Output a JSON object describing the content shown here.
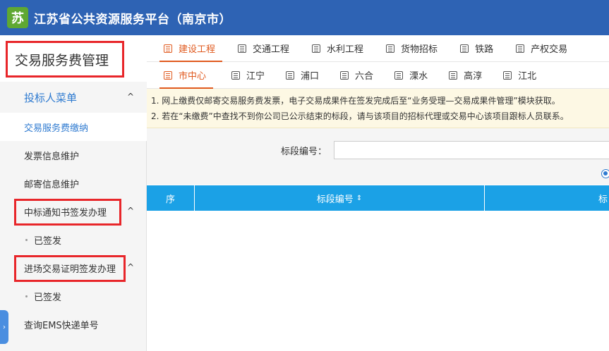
{
  "header": {
    "logo_text": "苏",
    "title": "江苏省公共资源服务平台（南京市）"
  },
  "sidebar": {
    "title": "交易服务费管理",
    "items": [
      {
        "label": "投标人菜单",
        "kind": "group-primary",
        "caret": "^"
      },
      {
        "label": "交易服务费缴纳",
        "kind": "active"
      },
      {
        "label": "发票信息维护",
        "kind": "item"
      },
      {
        "label": "邮寄信息维护",
        "kind": "item"
      },
      {
        "label": "中标通知书签发办理",
        "kind": "group",
        "caret": "^"
      },
      {
        "label": "已签发",
        "kind": "sub"
      },
      {
        "label": "进场交易证明签发办理",
        "kind": "group",
        "caret": "^"
      },
      {
        "label": "已签发",
        "kind": "sub"
      },
      {
        "label": "查询EMS快递单号",
        "kind": "item"
      }
    ],
    "toggle": "›"
  },
  "tabs_row1": [
    {
      "label": "建设工程",
      "active": true
    },
    {
      "label": "交通工程",
      "active": false
    },
    {
      "label": "水利工程",
      "active": false
    },
    {
      "label": "货物招标",
      "active": false
    },
    {
      "label": "铁路",
      "active": false
    },
    {
      "label": "产权交易",
      "active": false
    }
  ],
  "tabs_row2": [
    {
      "label": "市中心",
      "active": true
    },
    {
      "label": "江宁",
      "active": false
    },
    {
      "label": "浦口",
      "active": false
    },
    {
      "label": "六合",
      "active": false
    },
    {
      "label": "溧水",
      "active": false
    },
    {
      "label": "高淳",
      "active": false
    },
    {
      "label": "江北",
      "active": false
    }
  ],
  "notice": {
    "line1": "1. 网上缴费仅邮寄交易服务费发票，电子交易成果件在签发完成后至“业务受理—交易成果件管理”模块获取。",
    "line2": "2. 若在“未缴费”中查找不到你公司已公示结束的标段，请与该项目的招标代理或交易中心该项目跟标人员联系。"
  },
  "search": {
    "label": "标段编号：",
    "value": ""
  },
  "table": {
    "headers": {
      "seq": "序",
      "code": "标段编号",
      "code_sort": "⇕",
      "more": "标"
    }
  }
}
